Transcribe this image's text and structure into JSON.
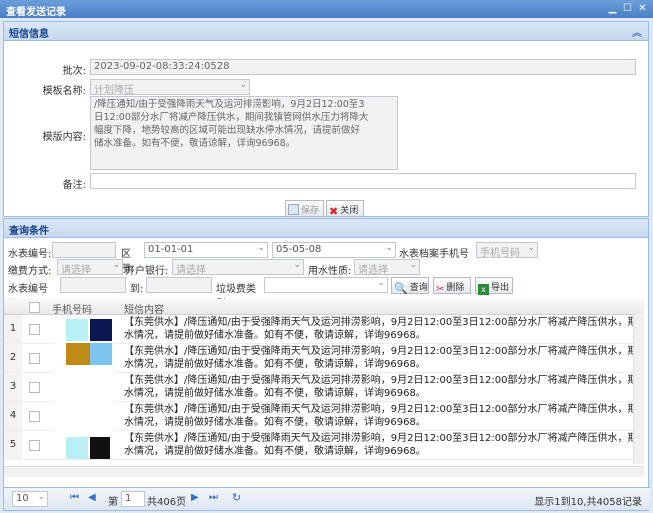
{
  "window": {
    "title": "查看发送记录"
  },
  "sms_panel": {
    "title": "短信信息",
    "batch_label": "批次:",
    "batch_value": "2023-09-02-08:33:24:0528",
    "template_name_label": "模板名称:",
    "template_name_value": "计划降压",
    "template_content_label": "模版内容:",
    "template_content_lines": [
      "/降压通知/由于受强降雨天气及运河排涝影响，9月2日12:00至3",
      "日12:00部分水厂将减产降压供水，期间我镇管网供水压力将降大",
      "幅度下降，地势较高的区域可能出现缺水停水情况，请提前做好",
      "储水准备。如有不便，敬请谅解，详询96968。"
    ],
    "remark_label": "备注:",
    "remark_value": "",
    "save_label": "保存",
    "close_label": "关闭"
  },
  "query_panel": {
    "title": "查询条件",
    "meter_no_label": "水表编号:",
    "area_label": "区册:",
    "area_from": "01-01-01",
    "area_to": "05-05-08",
    "phone_label": "水表档案手机号码:",
    "phone_placeholder": "手机号码",
    "pay_method_label": "缴费方式:",
    "pay_method_placeholder": "请选择",
    "bank_label": "开户银行:",
    "bank_placeholder": "请选择",
    "water_nature_label": "用水性质:",
    "water_nature_placeholder": "请选择",
    "meter_from_label": "水表编号从:",
    "meter_to_label": "到:",
    "garbage_label": "垃圾费类型:",
    "search_label": "查询",
    "delete_label": "删除",
    "export_label": "导出"
  },
  "grid": {
    "col_phone": "手机号码",
    "col_content": "短信内容",
    "rows": [
      {
        "n": "1",
        "l1": "【东莞供水】/降压通知/由于受强降雨天气及运河排涝影响，9月2日12:00至3日12:00部分水厂将减产降压供水，期间我镇管网供水压",
        "l2": "水情况，请提前做好储水准备。如有不便，敬请谅解，详询96968。"
      },
      {
        "n": "2",
        "l1": "【东莞供水】/降压通知/由于受强降雨天气及运河排涝影响，9月2日12:00至3日12:00部分水厂将减产降压供水，期间我镇管网供水压",
        "l2": "水情况，请提前做好储水准备。如有不便，敬请谅解，详询96968。"
      },
      {
        "n": "3",
        "l1": "【东莞供水】/降压通知/由于受强降雨天气及运河排涝影响，9月2日12:00至3日12:00部分水厂将减产降压供水，期间我镇管网供水压",
        "l2": "水情况，请提前做好储水准备。如有不便，敬请谅解，详询96968。"
      },
      {
        "n": "4",
        "l1": "【东莞供水】/降压通知/由于受强降雨天气及运河排涝影响，9月2日12:00至3日12:00部分水厂将减产降压供水，期间我镇管网供水压",
        "l2": "水情况，请提前做好储水准备。如有不便，敬请谅解，详询96968。"
      },
      {
        "n": "5",
        "l1": "【东莞供水】/降压通知/由于受强降雨天气及运河排涝影响，9月2日12:00至3日12:00部分水厂将减产降压供水，期间我镇管网供水压",
        "l2": "水情况，请提前做好储水准备。如有不便，敬请谅解，详询96968。"
      }
    ]
  },
  "pager": {
    "page_size": "10",
    "page_prefix": "第",
    "page_current": "1",
    "page_total": "共406页",
    "summary": "显示1到10,共4058记录"
  },
  "colors": {
    "accent": "#15428b",
    "title_bar": "#4a7fc6"
  }
}
